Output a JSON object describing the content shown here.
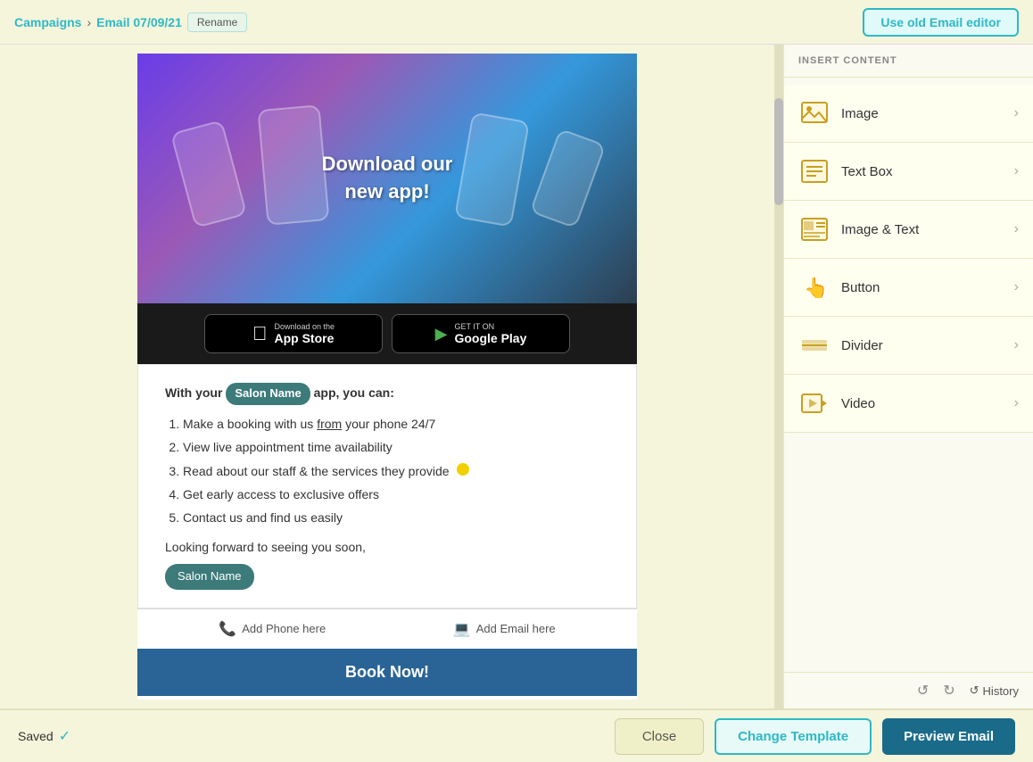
{
  "topbar": {
    "breadcrumb_campaigns": "Campaigns",
    "breadcrumb_separator": "›",
    "breadcrumb_email": "Email 07/09/21",
    "rename_label": "Rename",
    "use_old_editor_label": "Use old Email editor"
  },
  "banner": {
    "text_line1": "Download our",
    "text_line2": "new app!"
  },
  "app_buttons": {
    "apple_sub": "Download on the",
    "apple_main": "App Store",
    "google_sub": "GET IT ON",
    "google_main": "Google Play"
  },
  "text_section": {
    "intro": "With your",
    "salon_badge": "Salon Name",
    "intro_end": "app, you can:",
    "list_items": [
      "Make a booking with us from your phone 24/7",
      "View live appointment time availability",
      "Read about our staff & the services they provide",
      "Get early access to exclusive offers",
      "Contact us and find us easily"
    ],
    "closing": "Looking forward to seeing you soon,",
    "salon_btn": "Salon Name"
  },
  "contact_row": {
    "phone_label": "Add Phone here",
    "email_label": "Add Email here"
  },
  "book_now": {
    "label": "Book Now!"
  },
  "right_panel": {
    "header": "INSERT CONTENT",
    "items": [
      {
        "id": "image",
        "label": "Image",
        "icon": "🖼"
      },
      {
        "id": "text-box",
        "label": "Text Box",
        "icon": "📄"
      },
      {
        "id": "image-text",
        "label": "Image & Text",
        "icon": "🗃"
      },
      {
        "id": "button",
        "label": "Button",
        "icon": "👆"
      },
      {
        "id": "divider",
        "label": "Divider",
        "icon": "➖"
      },
      {
        "id": "video",
        "label": "Video",
        "icon": "▶"
      }
    ],
    "history_label": "History"
  },
  "bottom_bar": {
    "saved_label": "Saved",
    "close_label": "Close",
    "change_template_label": "Change Template",
    "preview_label": "Preview Email"
  }
}
